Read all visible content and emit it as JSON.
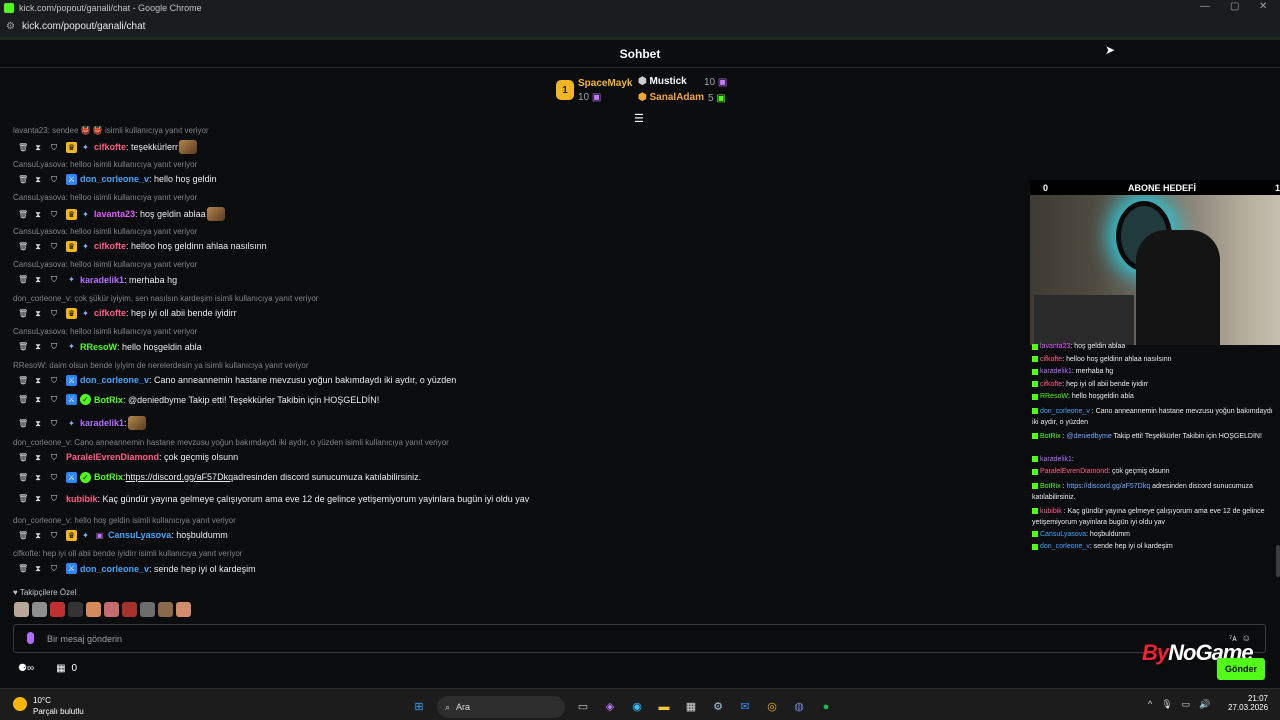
{
  "window": {
    "title": "kick.com/popout/ganali/chat - Google Chrome",
    "url": "kick.com/popout/ganali/chat",
    "minimize_icon": "—",
    "maximize_icon": "▢",
    "close_icon": "✕"
  },
  "header": {
    "title": "Sohbet"
  },
  "top_gifters": {
    "first": {
      "rank": "1",
      "name": "SpaceMayk",
      "count": "10"
    },
    "second": {
      "name": "Mustick",
      "count": "10"
    },
    "third": {
      "name": "SanalAdam",
      "count": "5"
    }
  },
  "chat": {
    "messages": [
      {
        "reply": "lavanta23: sendee 👹 👹 isimli kullanıcıya yanıt veriyor",
        "user": "cifkofte",
        "user_color": "#ff5a8a",
        "text": ": teşekkürlerr",
        "emote": true
      },
      {
        "reply": "CansuLyasova: helloo isimli kullanıcıya yanıt veriyor",
        "user": "don_corleone_v",
        "user_color": "#3ea6ff",
        "text": ": hello hoş geldin"
      },
      {
        "reply": "CansuLyasova: helloo isimli kullanıcıya yanıt veriyor",
        "user": "lavanta23",
        "user_color": "#e05cff",
        "text": ": hoş geldin ablaa",
        "emote": true
      },
      {
        "reply": "CansuLyasova: helloo isimli kullanıcıya yanıt veriyor",
        "user": "cifkofte",
        "user_color": "#ff5a8a",
        "text": ": helloo hoş geldinn ahlaa nasılsınn"
      },
      {
        "reply": "CansuLyasova: helloo isimli kullanıcıya yanıt veriyor",
        "user": "karadelik1",
        "user_color": "#b36bff",
        "text": ": merhaba hg"
      },
      {
        "reply": "don_corleone_v: çok şükür iyiyim, sen nasılsın kardeşim isimli kullanıcıya yanıt veriyor",
        "user": "cifkofte",
        "user_color": "#ff5a8a",
        "text": ": hep iyi oll abii bende iyidirr"
      },
      {
        "reply": "CansuLyasova: helloo isimli kullanıcıya yanıt veriyor",
        "user": "RResoW",
        "user_color": "#53fc18",
        "text": ": hello hoşgeldin abla"
      },
      {
        "reply": "RResoW: daim olsun bende iyiyim de nerelerdesin ya isimli kullanıcıya yanıt veriyor",
        "user": "don_corleone_v",
        "user_color": "#3ea6ff",
        "text": ": Cano anneannemin hastane mevzusu yoğun bakımdaydı iki aydır, o yüzden"
      },
      {
        "user": "BotRix",
        "user_color": "#53fc18",
        "text": ": @deniedbyme Takip etti! Teşekkürler Takibin için HOŞGELDİN!"
      },
      {
        "user": "karadelik1",
        "user_color": "#b36bff",
        "text": ":",
        "emote": true
      },
      {
        "reply": "don_corleone_v: Cano anneannemin hastane mevzusu yoğun bakımdaydı iki aydır, o yüzden isimli kullanıcıya yanıt veriyor",
        "user": "ParalelEvrenDiamond",
        "user_color": "#ff5a8a",
        "text": ": çok geçmiş olsunn"
      },
      {
        "user": "BotRix",
        "user_color": "#53fc18",
        "link": "https://discord.gg/aF57Dkq",
        "text": " adresinden discord sunucumuza katılabilirsiniz."
      },
      {
        "user": "kubibik",
        "user_color": "#ff5a8a",
        "text": ": Kaç gündür yayına gelmeye çalışıyorum ama eve 12 de gelince yetişemiyorum yayinlara bugün iyi oldu yav"
      },
      {
        "reply": "don_corleone_v: hello hoş geldin isimli kullanıcıya yanıt veriyor",
        "user": "CansuLyasova",
        "user_color": "#3ea6ff",
        "text": ": hoşbuldumm"
      },
      {
        "reply": "cifkofte: hep iyi oll abii bende iyidirr isimli kullanıcıya yanıt veriyor",
        "user": "don_corleone_v",
        "user_color": "#3ea6ff",
        "text": ": sende hep iyi ol kardeşim"
      }
    ]
  },
  "followers": {
    "label": "♥ Takipçilere Özel"
  },
  "input": {
    "placeholder": "Bir mesaj gönderin"
  },
  "bottom": {
    "points_count": "0"
  },
  "send_button": "Gönder",
  "watermark": {
    "by": "By",
    "rest": "NoGame"
  },
  "overlay": {
    "goal_left": "0",
    "goal_title": "ABONE HEDEFİ",
    "goal_right": "1",
    "chat": [
      {
        "user": "lavanta23",
        "color": "#e05cff",
        "text": " : hoş geldin ablaa"
      },
      {
        "user": "cifkofte",
        "color": "#ff5a8a",
        "text": " : helloo hoş geldinn ahlaa nasılsınn"
      },
      {
        "user": "karadelik1",
        "color": "#b36bff",
        "text": " : merhaba hg"
      },
      {
        "user": "cifkofte",
        "color": "#ff5a8a",
        "text": " : hep iyi oll abii bende iyidirr"
      },
      {
        "user": "RResoW",
        "color": "#53fc18",
        "text": " : hello hoşgeldin abla"
      },
      {
        "user": "don_corleone_v",
        "color": "#3ea6ff",
        "text": " : Cano anneannemin hastane mevzusu yoğun bakımdaydı iki aydır, o yüzden"
      },
      {
        "user": "BotRix",
        "color": "#53fc18",
        "text": " : ",
        "extra": "@deniedbyme",
        "text2": " Takip etti! Teşekkürler Takibin için HOŞGELDİN!"
      },
      {
        "user": "karadelik1",
        "color": "#b36bff",
        "text": " :"
      },
      {
        "user": "ParalelEvrenDiamond",
        "color": "#ff5a8a",
        "text": " : çok geçmiş olsunn"
      },
      {
        "user": "BotRix",
        "color": "#53fc18",
        "text": " : ",
        "extra": "https://discord.gg/aF57Dkq",
        "text2": " adresinden discord sunucumuza katılabilirsiniz."
      },
      {
        "user": "kubibik",
        "color": "#ff5a8a",
        "text": " : Kaç gündür yayına gelmeye çalışıyorum ama eve 12 de gelince yetişemiyorum yayinlara bugün iyi oldu yav"
      },
      {
        "user": "CansuLyasova",
        "color": "#3ea6ff",
        "text": " : hoşbuldumm"
      },
      {
        "user": "don_corleone_v",
        "color": "#3ea6ff",
        "text": " : sende hep iyi ol kardeşim"
      }
    ]
  },
  "taskbar": {
    "temp": "10°C",
    "weather": "Parçalı bulutlu",
    "search": "Ara",
    "time": "21:07",
    "date": "27.03.2026",
    "icons": [
      "windows-start",
      "search",
      "widgets",
      "task-view",
      "copilot",
      "edge",
      "file-explorer",
      "calculator",
      "steam",
      "mail",
      "chrome",
      "discord",
      "spotify"
    ]
  },
  "colors": {
    "kick_green": "#53fc18",
    "background": "#0b0c0d"
  }
}
